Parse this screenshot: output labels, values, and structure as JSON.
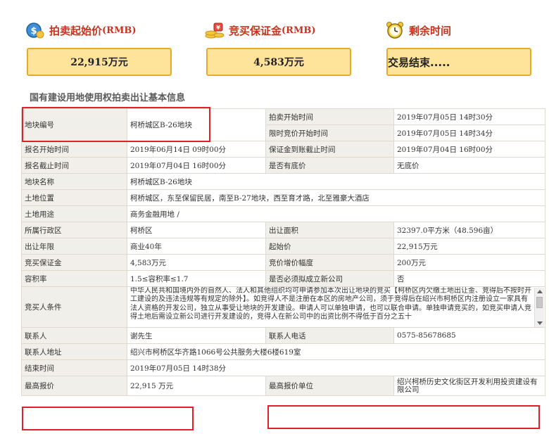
{
  "summary": {
    "start_price": {
      "label": "拍卖起始价",
      "unit_label": "(RMB)",
      "value": "22,915万元",
      "icon": "money-coin-icon"
    },
    "deposit": {
      "label": "竞买保证金",
      "unit_label": "(RMB)",
      "value": "4,583万元",
      "icon": "coin-stack-icon"
    },
    "remaining_time": {
      "label": "剩余时间",
      "value": "交易结束.....",
      "icon": "alarm-clock-icon"
    }
  },
  "section_title": "国有建设用地使用权拍卖出让基本信息",
  "rows": {
    "parcel_no": {
      "label": "地块编号",
      "value": "柯桥城区B-26地块"
    },
    "auction_start": {
      "label": "拍卖开始时间",
      "value": "2019年07月05日 14时30分"
    },
    "bidding_start": {
      "label": "限时竞价开始时间",
      "value": "2019年07月05日 14时34分"
    },
    "signup_start": {
      "label": "报名开始时间",
      "value": "2019年06月14日 09时00分"
    },
    "deposit_deadline": {
      "label": "保证金到账截止时间",
      "value": "2019年07月04日 16时00分"
    },
    "signup_end": {
      "label": "报名截止时间",
      "value": "2019年07月04日 16时00分"
    },
    "reserve_price": {
      "label": "是否有底价",
      "value": "无底价"
    },
    "parcel_name": {
      "label": "地块名称",
      "value": "柯桥城区B-26地块"
    },
    "location": {
      "label": "土地位置",
      "value": "柯桥城区，东至保留民居，南至B-27地块，西至育才路，北至雅豪大酒店"
    },
    "land_use": {
      "label": "土地用途",
      "value": "商务金融用地 /"
    },
    "district": {
      "label": "所属行政区",
      "value": "柯桥区"
    },
    "area": {
      "label": "出让面积",
      "value": "32397.0平方米（48.596亩）"
    },
    "term": {
      "label": "出让年限",
      "value": "商业40年"
    },
    "start_price": {
      "label": "起始价",
      "value": "22,915万元"
    },
    "deposit": {
      "label": "竞买保证金",
      "value": "4,583万元"
    },
    "increment": {
      "label": "竞价增价幅度",
      "value": "200万元"
    },
    "far": {
      "label": "容积率",
      "value": "1.5≤容积率≤1.7"
    },
    "new_company": {
      "label": "是否必须拟成立新公司",
      "value": "否"
    },
    "conditions": {
      "label": "竞买人条件",
      "value": "中华人民共和国境内外的自然人、法人和其他组织均可申请参加本次出让地块的竞买【柯桥区内欠缴土地出让金、竞得后不按时开工建设的及违法违规等有规定的除外】。如竞得人不是注册在本区的房地产公司，须于竞得后在绍兴市柯桥区内注册设立一家具有法人资格的开发公司，独立从事受让地块的开发建设。申请人可以单独申请，也可以联合申请。单独申请竞买的，如竞买申请人竞得土地后需设立新公司进行开发建设的，竞得人在新公司中的出资比例不得低于百分之五十"
    },
    "contact": {
      "label": "联系人",
      "value": "谢先生"
    },
    "phone": {
      "label": "联系人电话",
      "value": "0575-85678685"
    },
    "address": {
      "label": "联系人地址",
      "value": "绍兴市柯桥区华齐路1066号公共服务大楼6楼619室"
    },
    "end_time": {
      "label": "结束时间",
      "value": "2019年07月05日 14时38分"
    },
    "top_bid": {
      "label": "最高报价",
      "value": "22,915 万元"
    },
    "top_bidder": {
      "label": "最高报价单位",
      "value": "绍兴柯桥历史文化街区开发利用投资建设有限公司"
    }
  },
  "colors": {
    "accent_red": "#c8321e",
    "box_fill": "#fde49a",
    "box_border": "#e7ab2a",
    "highlight": "#e0202e",
    "label_bg": "#f1efe9"
  }
}
